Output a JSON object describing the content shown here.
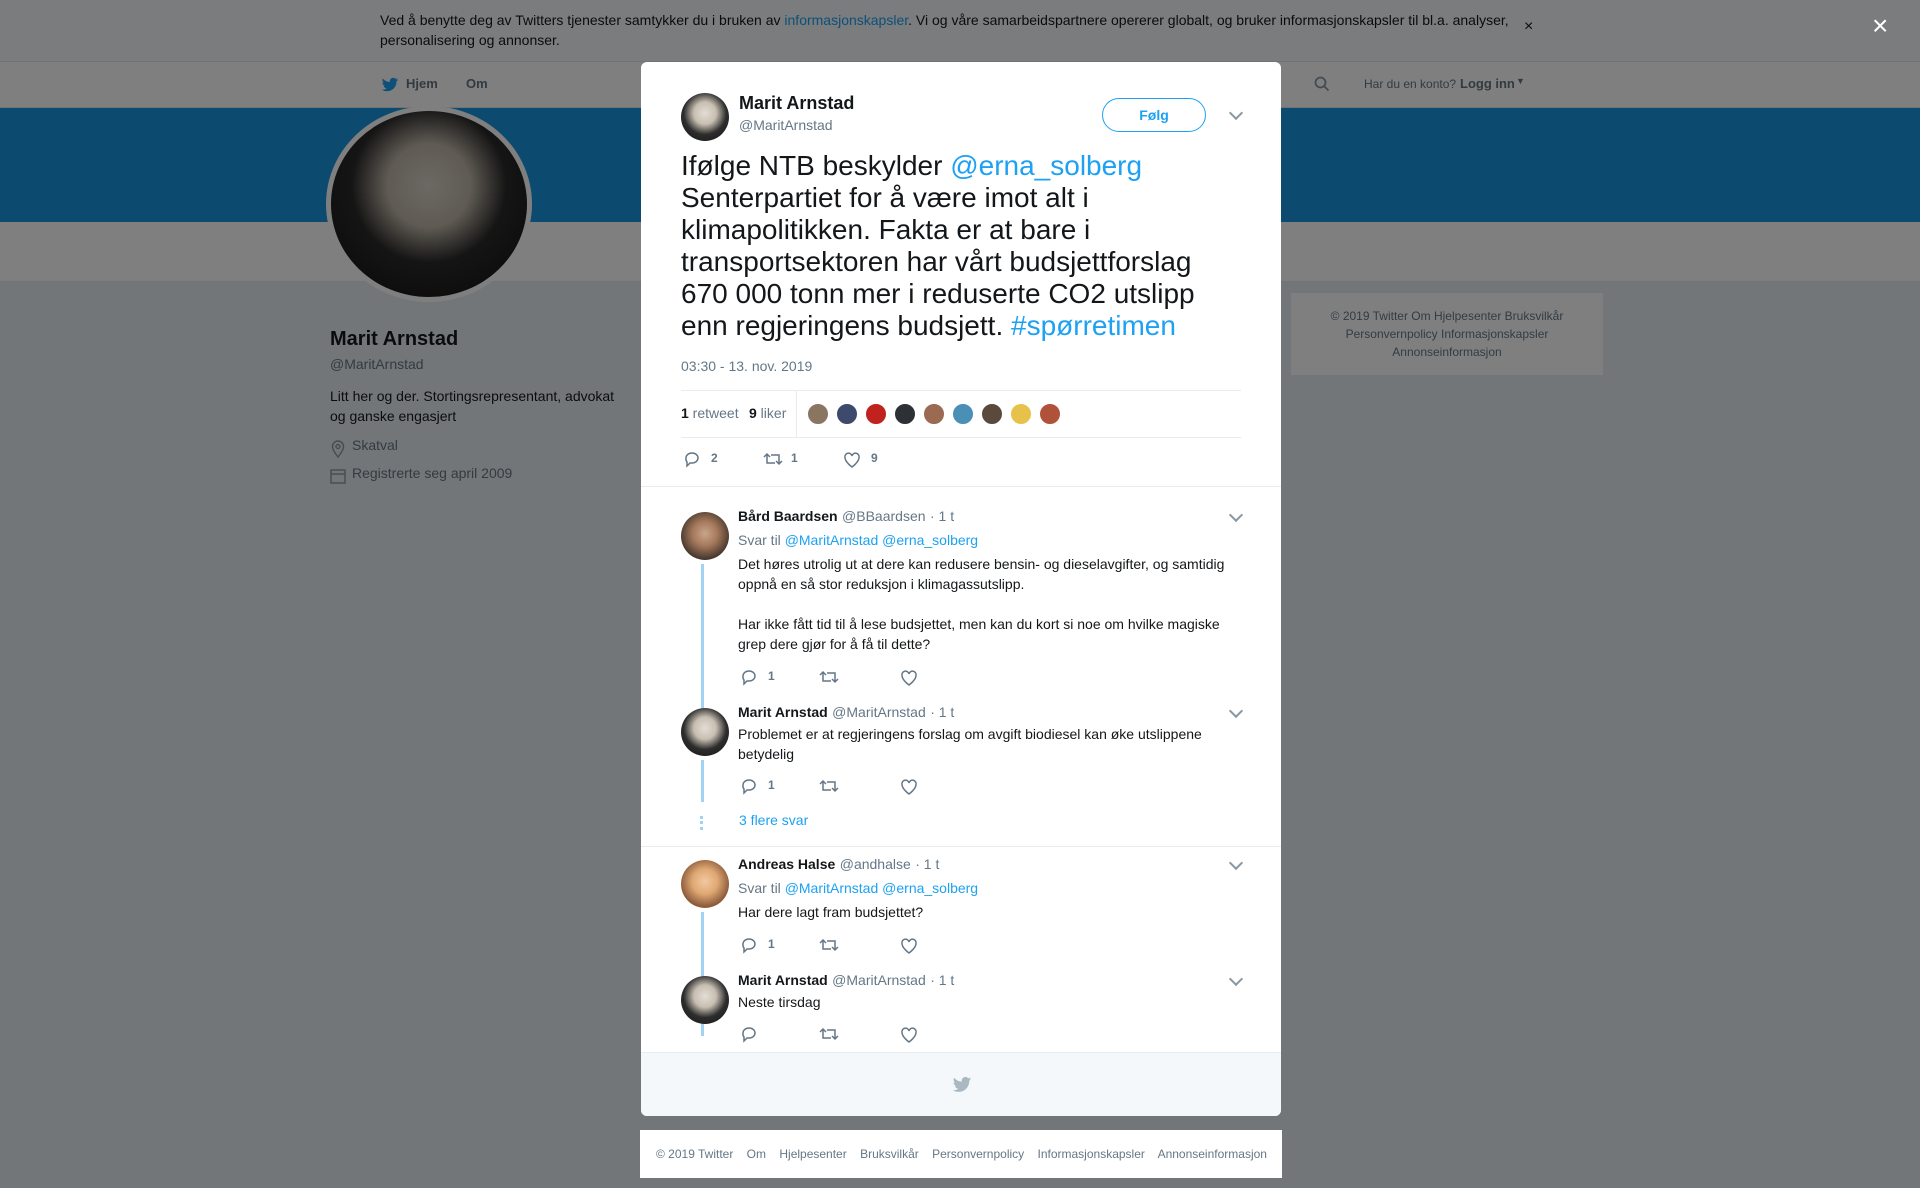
{
  "cookie_banner": {
    "text_before": "Ved å benytte deg av Twitters tjenester samtykker du i bruken av ",
    "link": "informasjonskapsler",
    "text_after": ". Vi og våre samarbeidspartnere opererer globalt, og bruker informasjonskapsler til bl.a. analyser, personalisering og annonser.",
    "close": "×"
  },
  "nav": {
    "home": "Hjem",
    "about": "Om",
    "account_prompt": "Har du en konto?",
    "login": "Logg inn"
  },
  "profile": {
    "name": "Marit Arnstad",
    "handle": "@MaritArnstad",
    "bio": "Litt her og der. Stortingsrepresentant, advokat og ganske engasjert",
    "location": "Skatval",
    "joined": "Registrerte seg april 2009"
  },
  "side_footer": {
    "line1": "© 2019 Twitter   Om   Hjelpesenter   Bruksvilkår",
    "line2": "Personvernpolicy   Informasjonskapsler",
    "line3": "Annonseinformasjon"
  },
  "modal": {
    "close": "×",
    "tweet": {
      "name": "Marit Arnstad",
      "handle": "@MaritArnstad",
      "follow": "Følg",
      "text_1": "Ifølge NTB beskylder ",
      "mention": "@erna_solberg",
      "text_2": " Senterpartiet for å være imot alt i klimapolitikken. Fakta er at bare i transportsektoren har vårt budsjettforslag 670 000 tonn mer i reduserte CO2 utslipp enn regjeringens budsjett. ",
      "hashtag": "#spørretimen",
      "time": "03:30 - 13. nov. 2019",
      "retweets_count": "1",
      "retweets_label": " retweet",
      "likes_count": "9",
      "likes_label": " liker",
      "reply_count": "2",
      "retweet_count_action": "1",
      "like_count_action": "9"
    },
    "replies": [
      {
        "name": "Bård Baardsen",
        "handle": "@BBaardsen",
        "time": "· 1 t",
        "reply_to_label": "Svar til ",
        "reply_to_1": "@MaritArnstad",
        "reply_to_2": "@erna_solberg",
        "text": "Det høres utrolig ut at dere kan redusere bensin- og dieselavgifter, og samtidig oppnå en så stor reduksjon i klimagassutslipp.",
        "text_2": "Har ikke fått tid til å lese budsjettet, men kan du kort si noe om hvilke magiske grep dere gjør for å få til dette?",
        "reply_count": "1"
      },
      {
        "name": "Marit Arnstad",
        "handle": "@MaritArnstad",
        "time": "· 1 t",
        "text": "Problemet er at regjeringens forslag om avgift biodiesel kan øke utslippene betydelig",
        "reply_count": "1",
        "more": "3 flere svar"
      },
      {
        "name": "Andreas Halse",
        "handle": "@andhalse",
        "time": "· 1 t",
        "reply_to_label": "Svar til ",
        "reply_to_1": "@MaritArnstad",
        "reply_to_2": "@erna_solberg",
        "text": "Har dere lagt fram budsjettet?",
        "reply_count": "1"
      },
      {
        "name": "Marit Arnstad",
        "handle": "@MaritArnstad",
        "time": "· 1 t",
        "text": "Neste tirsdag"
      }
    ]
  },
  "bottom_footer": [
    "© 2019 Twitter",
    "Om",
    "Hjelpesenter",
    "Bruksvilkår",
    "Personvernpolicy",
    "Informasjonskapsler",
    "Annonseinformasjon"
  ],
  "colors": {
    "accent": "#1da1f2",
    "banner": "#1b95e0",
    "thread": "#a2d3f5"
  },
  "icons": [
    "twitter-bird-icon",
    "search-icon",
    "location-icon",
    "calendar-icon",
    "reply-icon",
    "retweet-icon",
    "heart-icon",
    "chevron-down-icon",
    "close-icon"
  ]
}
